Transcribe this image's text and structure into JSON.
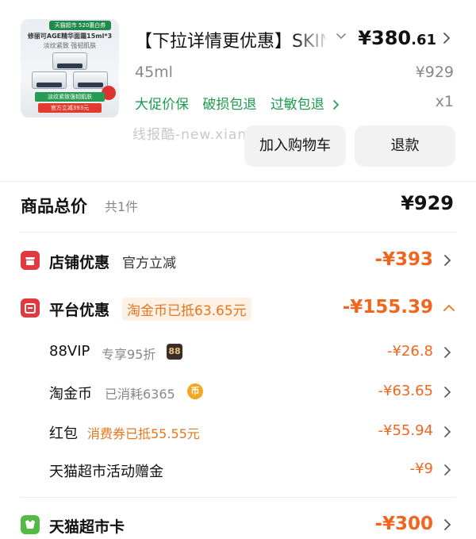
{
  "product": {
    "thumb": {
      "ribbon": "天猫超市 520惠白券",
      "line1": "修丽可AGE精华面霜15ml*3",
      "line2": "淡纹紧致 强韧肌肤",
      "green_bar": "淡纹紧致强韧肌肤",
      "red_bar": "官方立减393元"
    },
    "title": "【下拉详情更优惠】SKINCEUTICALS",
    "price_main": "¥380",
    "price_decimal": ".61",
    "spec": "45ml",
    "original_price": "¥929",
    "quantity": "x1",
    "services": [
      "大促价保",
      "破损包退",
      "过敏包退"
    ],
    "watermark": "线报酷-new.xianbao.fun",
    "buttons": {
      "add_to_cart": "加入购物车",
      "refund": "退款"
    }
  },
  "summary": {
    "label": "商品总价",
    "count": "共1件",
    "value": "¥929"
  },
  "discounts": {
    "store": {
      "label": "店铺优惠",
      "sub": "官方立减",
      "amount": "-¥393"
    },
    "platform": {
      "label": "平台优惠",
      "tag": "淘金币已抵63.65元",
      "amount": "-¥155.39",
      "items": [
        {
          "label": "88VIP",
          "note": "专享95折",
          "badge": "88",
          "amount": "-¥26.8"
        },
        {
          "label": "淘金币",
          "note": "已消耗6365",
          "badge": "币",
          "amount": "-¥63.65"
        },
        {
          "label": "红包",
          "note": "消费券已抵55.55元",
          "amount": "-¥55.94"
        },
        {
          "label": "天猫超市活动赠金",
          "amount": "-¥9"
        }
      ]
    },
    "tmall_card": {
      "label": "天猫超市卡",
      "amount": "-¥300"
    }
  },
  "colors": {
    "accent_orange": "#f0661e",
    "service_green": "#1d9b4e",
    "icon_red": "#e0393e",
    "icon_green": "#55b946"
  }
}
